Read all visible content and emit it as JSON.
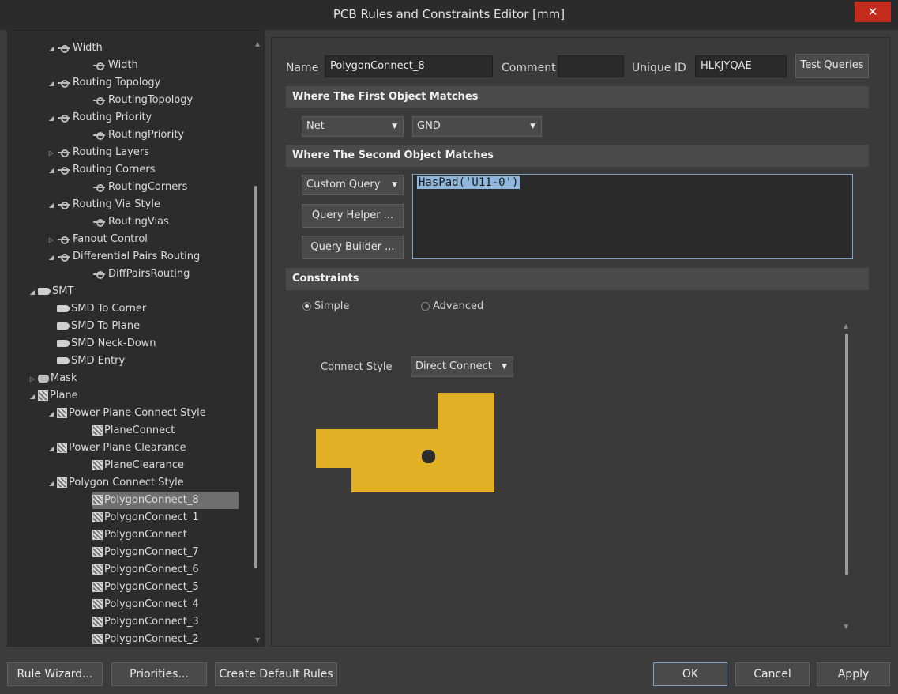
{
  "window": {
    "title": "PCB Rules and Constraints Editor [mm]",
    "close_glyph": "✕"
  },
  "tree": {
    "items": [
      {
        "label": "Width",
        "depth": 2,
        "arrow": "◢",
        "icon": "width-icon"
      },
      {
        "label": "Width",
        "depth": 3,
        "arrow": "",
        "icon": "width-icon"
      },
      {
        "label": "Routing Topology",
        "depth": 2,
        "arrow": "◢",
        "icon": "width-icon"
      },
      {
        "label": "RoutingTopology",
        "depth": 3,
        "arrow": "",
        "icon": "width-icon"
      },
      {
        "label": "Routing Priority",
        "depth": 2,
        "arrow": "◢",
        "icon": "width-icon"
      },
      {
        "label": "RoutingPriority",
        "depth": 3,
        "arrow": "",
        "icon": "width-icon"
      },
      {
        "label": "Routing Layers",
        "depth": 2,
        "arrow": "▷",
        "icon": "width-icon"
      },
      {
        "label": "Routing Corners",
        "depth": 2,
        "arrow": "◢",
        "icon": "width-icon"
      },
      {
        "label": "RoutingCorners",
        "depth": 3,
        "arrow": "",
        "icon": "width-icon"
      },
      {
        "label": "Routing Via Style",
        "depth": 2,
        "arrow": "◢",
        "icon": "width-icon"
      },
      {
        "label": "RoutingVias",
        "depth": 3,
        "arrow": "",
        "icon": "width-icon"
      },
      {
        "label": "Fanout Control",
        "depth": 2,
        "arrow": "▷",
        "icon": "width-icon"
      },
      {
        "label": "Differential Pairs Routing",
        "depth": 2,
        "arrow": "◢",
        "icon": "width-icon"
      },
      {
        "label": "DiffPairsRouting",
        "depth": 3,
        "arrow": "",
        "icon": "width-icon"
      },
      {
        "label": "SMT",
        "depth": 1,
        "arrow": "◢",
        "icon": "smd-icon"
      },
      {
        "label": "SMD To Corner",
        "depth": 2,
        "arrow": "",
        "icon": "smd-icon"
      },
      {
        "label": "SMD To Plane",
        "depth": 2,
        "arrow": "",
        "icon": "smd-icon"
      },
      {
        "label": "SMD Neck-Down",
        "depth": 2,
        "arrow": "",
        "icon": "smd-icon"
      },
      {
        "label": "SMD Entry",
        "depth": 2,
        "arrow": "",
        "icon": "smd-icon"
      },
      {
        "label": "Mask",
        "depth": 1,
        "arrow": "▷",
        "icon": "mask-icon"
      },
      {
        "label": "Plane",
        "depth": 1,
        "arrow": "◢",
        "icon": "plane-icon"
      },
      {
        "label": "Power Plane Connect Style",
        "depth": 2,
        "arrow": "◢",
        "icon": "plane-icon"
      },
      {
        "label": "PlaneConnect",
        "depth": 3,
        "arrow": "",
        "icon": "plane-icon"
      },
      {
        "label": "Power Plane Clearance",
        "depth": 2,
        "arrow": "◢",
        "icon": "plane-icon"
      },
      {
        "label": "PlaneClearance",
        "depth": 3,
        "arrow": "",
        "icon": "plane-icon"
      },
      {
        "label": "Polygon Connect Style",
        "depth": 2,
        "arrow": "◢",
        "icon": "plane-icon"
      },
      {
        "label": "PolygonConnect_8",
        "depth": 3,
        "arrow": "",
        "icon": "plane-icon",
        "selected": true
      },
      {
        "label": "PolygonConnect_1",
        "depth": 3,
        "arrow": "",
        "icon": "plane-icon"
      },
      {
        "label": "PolygonConnect",
        "depth": 3,
        "arrow": "",
        "icon": "plane-icon"
      },
      {
        "label": "PolygonConnect_7",
        "depth": 3,
        "arrow": "",
        "icon": "plane-icon"
      },
      {
        "label": "PolygonConnect_6",
        "depth": 3,
        "arrow": "",
        "icon": "plane-icon"
      },
      {
        "label": "PolygonConnect_5",
        "depth": 3,
        "arrow": "",
        "icon": "plane-icon"
      },
      {
        "label": "PolygonConnect_4",
        "depth": 3,
        "arrow": "",
        "icon": "plane-icon"
      },
      {
        "label": "PolygonConnect_3",
        "depth": 3,
        "arrow": "",
        "icon": "plane-icon"
      },
      {
        "label": "PolygonConnect_2",
        "depth": 3,
        "arrow": "",
        "icon": "plane-icon"
      }
    ]
  },
  "rule": {
    "name_label": "Name",
    "name_value": "PolygonConnect_8",
    "comment_label": "Comment",
    "comment_value": "",
    "uid_label": "Unique ID",
    "uid_value": "HLKJYQAE",
    "test_queries": "Test Queries"
  },
  "first_match": {
    "heading": "Where The First Object Matches",
    "type": "Net",
    "value": "GND"
  },
  "second_match": {
    "heading": "Where The Second Object Matches",
    "type": "Custom Query",
    "query_helper": "Query Helper ...",
    "query_builder": "Query Builder ...",
    "query": "HasPad('U11-0')"
  },
  "constraints": {
    "heading": "Constraints",
    "simple": "Simple",
    "advanced": "Advanced",
    "mode": "Simple",
    "connect_style_label": "Connect Style",
    "connect_style_value": "Direct Connect",
    "preview_color": "#e2b027"
  },
  "footer": {
    "rule_wizard": "Rule Wizard...",
    "priorities": "Priorities...",
    "create_defaults": "Create Default Rules",
    "ok": "OK",
    "cancel": "Cancel",
    "apply": "Apply"
  }
}
